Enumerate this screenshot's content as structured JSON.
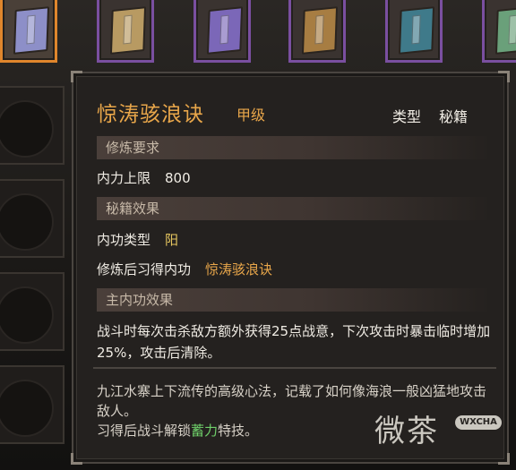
{
  "slots": [
    {
      "icon": "book-icon",
      "color": "#8d8fc8",
      "selected": true
    },
    {
      "icon": "book-icon",
      "color": "#b89a62"
    },
    {
      "icon": "book-icon",
      "color": "#7b67b8"
    },
    {
      "icon": "book-icon",
      "color": "#a77d42"
    },
    {
      "icon": "book-icon",
      "color": "#3f7a8a"
    },
    {
      "icon": "book-icon",
      "color": "#6aa07a"
    }
  ],
  "item": {
    "name": "惊涛骇浪诀",
    "grade": "甲级",
    "type_label": "类型",
    "type_value": "秘籍"
  },
  "sections": {
    "requirements": "修炼要求",
    "effects": "秘籍效果",
    "main_effect": "主内功效果"
  },
  "requirements": {
    "neili_label": "内力上限",
    "neili_value": "800"
  },
  "effects": {
    "kind_label": "内功类型",
    "kind_value": "阳",
    "learn_label": "修炼后习得内功",
    "learn_value": "惊涛骇浪诀"
  },
  "main_effect_text": "战斗时每次击杀敌方额外获得25点战意，下次攻击时暴击临时增加25%，攻击后清除。",
  "flavor": {
    "line1": "九江水寨上下流传的高级心法，记载了如何像海浪一般凶猛地攻击敌人。",
    "line2_pre": "习得后战斗解锁",
    "line2_skill": "蓄力",
    "line2_post": "特技。"
  },
  "watermark": {
    "text": "微茶",
    "badge": "WXCHA"
  },
  "colors": {
    "title": "#e8a64a",
    "slot_border": "#7a4fa0",
    "slot_selected": "#e0862c",
    "skill_green": "#6fd06a"
  }
}
